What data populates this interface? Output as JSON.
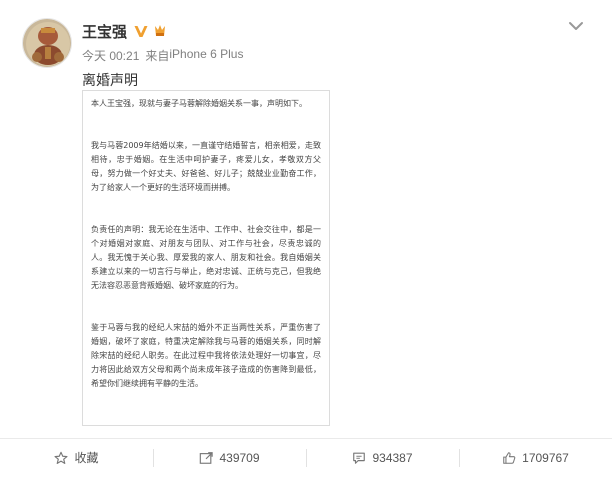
{
  "post": {
    "author": "王宝强",
    "time": "今天 00:21",
    "source_prefix": "来自",
    "source": "iPhone 6 Plus",
    "text": "离婚声明",
    "statement_paragraphs": [
      "本人王宝强，现就与妻子马蓉解除婚姻关系一事，声明如下。",
      "我与马蓉2009年结婚以来，一直谨守结婚誓言，相亲相爱，走致相待，忠于婚姻。在生活中呵护妻子，疼爱儿女，孝敬双方父母，努力做一个好丈夫、好爸爸、好儿子；兢兢业业勤奋工作，为了给家人一个更好的生活环境而拼搏。",
      "负责任的声明：我无论在生活中、工作中、社会交往中，都是一个对婚姻对家庭、对朋友与团队、对工作与社会，尽责忠诚的人。我无愧于关心我、厚爱我的家人、朋友和社会。我自婚姻关系建立以来的一切言行与举止，绝对忠诚、正统与克己，但我绝无法容忍恶意背叛婚姻、破坏家庭的行为。",
      "鉴于马蓉与我的经纪人宋喆的婚外不正当两性关系，严重伤害了婚姻，破坏了家庭，特重决定解除我与马蓉的婚姻关系，同时解除宋喆的经纪人职务。在此过程中我将依法处理好一切事宜，尽力将因此给双方父母和两个尚未成年孩子造成的伤害降到最低，希望你们继续拥有平静的生活。"
    ]
  },
  "actions": {
    "favorite": "收藏",
    "repost_count": "439709",
    "comment_count": "934387",
    "like_count": "1709767"
  },
  "icons": {
    "menu": "chevron-down-icon",
    "verified": "verified-v-icon",
    "level": "member-badge-icon",
    "favorite": "star-icon",
    "repost": "repost-icon",
    "comment": "comment-icon",
    "like": "thumbs-up-icon"
  },
  "colors": {
    "accent": "#f0a030",
    "meta_text": "#808080",
    "name_text": "#333333"
  }
}
